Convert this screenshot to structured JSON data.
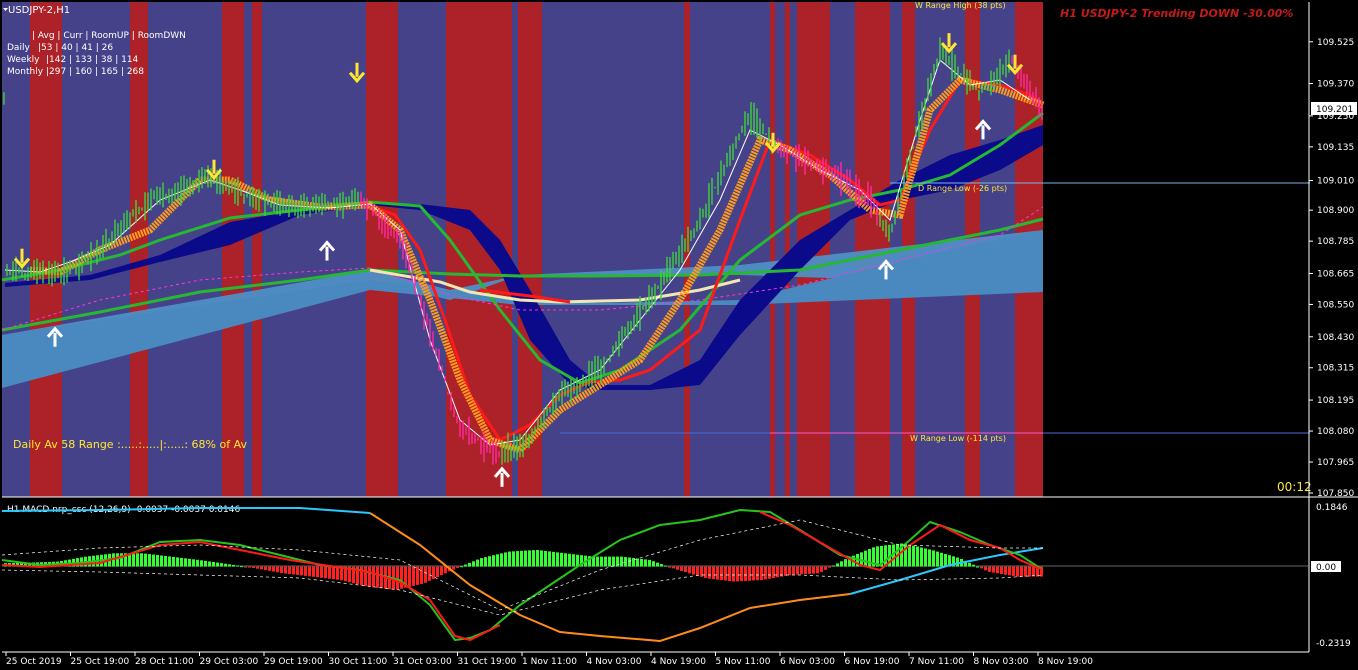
{
  "window": {
    "symbol_title": "USDJPY-2,H1",
    "banner": "H1 USDJPY-2 Trending DOWN -30.00%",
    "timer": "00:12"
  },
  "stats": {
    "header": "| Avg | Curr | RoomUP | RoomDWN",
    "rows": [
      {
        "label": "Daily",
        "values": "|53 | 40 | 41 | 26"
      },
      {
        "label": "Weekly",
        "values": "|142 | 133 | 38 | 114"
      },
      {
        "label": "Monthly",
        "values": "|297 | 160 | 165 | 268"
      }
    ],
    "daily_avg": "Daily Av 58  Range :.....:.....|:.....:  68% of Av"
  },
  "levels": {
    "w_high": "W Range High (38 pts)",
    "d_low": "D Range Low  (-26 pts)",
    "w_low": "W Range Low  (-114 pts)"
  },
  "chart_data": {
    "type": "line",
    "title": "USDJPY-2,H1",
    "xlabel": "",
    "ylabel": "",
    "ylim": [
      107.85,
      109.58
    ],
    "y_ticks": [
      "109.525",
      "109.370",
      "109.250",
      "109.135",
      "109.010",
      "108.900",
      "108.785",
      "108.665",
      "108.550",
      "108.430",
      "108.315",
      "108.195",
      "108.080",
      "107.965",
      "107.850"
    ],
    "current_price": "109.201",
    "x_ticks": [
      "25 Oct 2019",
      "25 Oct 19:00",
      "28 Oct 11:00",
      "29 Oct 03:00",
      "29 Oct 19:00",
      "30 Oct 11:00",
      "31 Oct 03:00",
      "31 Oct 19:00",
      "1 Nov 11:00",
      "4 Nov 03:00",
      "4 Nov 19:00",
      "5 Nov 11:00",
      "6 Nov 03:00",
      "6 Nov 19:00",
      "7 Nov 11:00",
      "8 Nov 03:00",
      "8 Nov 19:00"
    ],
    "series": [
      {
        "values": [
          108.63,
          108.62,
          108.75,
          109.02,
          108.94,
          108.88,
          108.83,
          108.55,
          108.05,
          107.97,
          108.38,
          108.9,
          109.15,
          108.95,
          108.9,
          109.48,
          109.21
        ]
      }
    ],
    "level_lines": {
      "d_low": 108.94,
      "w_low": 108.07
    },
    "arrows": {
      "down_yellow": [
        [
          22,
          108.72
        ],
        [
          214,
          109.05
        ],
        [
          357,
          109.41
        ],
        [
          773,
          109.15
        ],
        [
          949,
          109.52
        ],
        [
          1015,
          109.44
        ]
      ],
      "up_white": [
        [
          55,
          108.43
        ],
        [
          327,
          108.75
        ],
        [
          502,
          107.91
        ],
        [
          886,
          108.68
        ],
        [
          983,
          109.2
        ]
      ]
    }
  },
  "macd": {
    "label": "H1 MACD nrp_csc (12,26,9) -0.0037 -0.0037 0.0146",
    "y_ticks": [
      "0.1846",
      "0.00",
      "-0.2319"
    ],
    "ylim": [
      -0.2319,
      0.1846
    ],
    "histogram": [
      0.01,
      0.012,
      0.015,
      0.03,
      0.04,
      0.04,
      0.03,
      0.02,
      0.008,
      -0.005,
      -0.02,
      -0.03,
      -0.04,
      -0.06,
      -0.07,
      -0.05,
      -0.01,
      0.025,
      0.045,
      0.05,
      0.04,
      0.03,
      0.03,
      0.02,
      -0.01,
      -0.035,
      -0.045,
      -0.04,
      -0.025,
      -0.02,
      0.025,
      0.06,
      0.07,
      0.05,
      0.025,
      -0.015,
      -0.03,
      -0.03
    ],
    "main_line": [
      0.01,
      0.0,
      0.01,
      0.03,
      0.07,
      0.05,
      0.03,
      0.0,
      -0.02,
      -0.1,
      -0.18,
      -0.22,
      -0.19,
      -0.13,
      -0.06,
      0.0,
      0.05,
      0.09,
      0.13,
      0.16,
      0.17,
      0.16,
      0.13,
      0.06,
      0.0,
      -0.02,
      0.09,
      0.13,
      0.07,
      0.03,
      -0.02,
      -0.04
    ],
    "trend_line": [
      0.16,
      0.17,
      0.17,
      0.17,
      0.16,
      0.13,
      0.05,
      -0.05,
      -0.15,
      -0.2,
      -0.21,
      -0.2,
      -0.17,
      -0.12,
      -0.08,
      -0.06,
      -0.04,
      -0.01,
      0.02,
      0.04,
      0.06
    ]
  }
}
